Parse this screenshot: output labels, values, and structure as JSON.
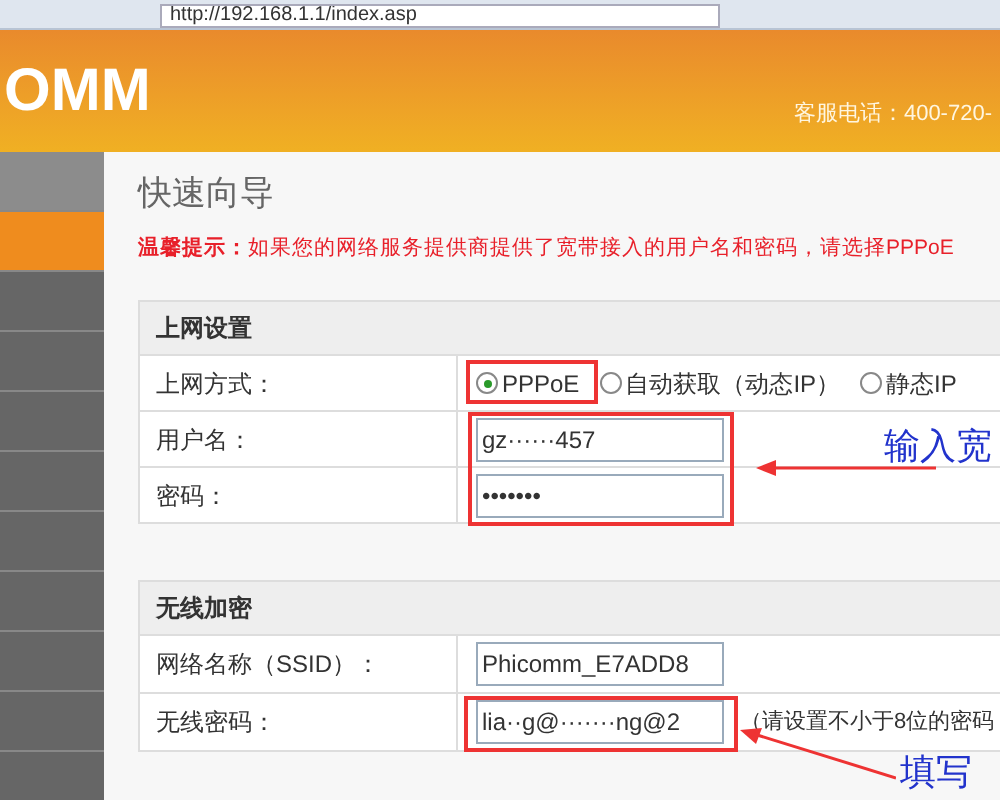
{
  "browser": {
    "address": "http://192.168.1.1/index.asp"
  },
  "header": {
    "logo": "OMM",
    "hotline": "客服电话：400-720-"
  },
  "sidebar": {
    "items": [
      {
        "selected": false
      },
      {
        "selected": true
      },
      {
        "selected": false
      },
      {
        "selected": false
      },
      {
        "selected": false
      },
      {
        "selected": false
      },
      {
        "selected": false
      },
      {
        "selected": false
      },
      {
        "selected": false
      },
      {
        "selected": false
      }
    ]
  },
  "page": {
    "title": "快速向导",
    "notice": "**温馨提示：**如果您的网络服务提供商提供了宽带接入的用户名和密码，请选择PPPoE"
  },
  "sections": [
    {
      "title": "上网设置",
      "rows": [
        {
          "kind": "radio",
          "label": "上网方式：",
          "options": [
            {
              "label": "PPPoE",
              "selected": true
            },
            {
              "label": "自动获取（动态IP）",
              "selected": false
            },
            {
              "label": "静态IP",
              "selected": false
            }
          ]
        },
        {
          "kind": "input",
          "label": "用户名：",
          "value": "gz······457"
        },
        {
          "kind": "input",
          "label": "密码：",
          "value": "•••••••"
        }
      ]
    },
    {
      "title": "无线加密",
      "rows": [
        {
          "kind": "input",
          "label": "网络名称（SSID）：",
          "value": "Phicomm_E7ADD8"
        },
        {
          "kind": "input",
          "label": "无线密码：",
          "value": "lia··g@·······ng@2",
          "hint": "（请设置不小于8位的密码"
        }
      ]
    }
  ],
  "annotations": [
    {
      "text": "输入宽"
    },
    {
      "text": "填写"
    }
  ]
}
